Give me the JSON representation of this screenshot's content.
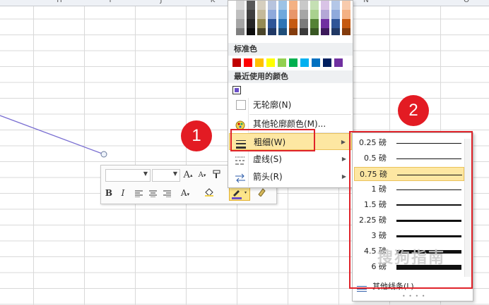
{
  "sheet": {
    "column_letters": [
      "H",
      "I",
      "J",
      "K",
      "N",
      "O"
    ]
  },
  "color_menu": {
    "standard_colors_title": "标准色",
    "recent_colors_title": "最近使用的颜色",
    "theme_columns": [
      [
        "#d8d8d8",
        "#bfbfbf",
        "#a5a5a5",
        "#7f7f7f"
      ],
      [
        "#595959",
        "#3f3f3f",
        "#262626",
        "#0c0c0c"
      ],
      [
        "#d6cfbf",
        "#c4b99a",
        "#948a54",
        "#4a452a"
      ],
      [
        "#b7c4de",
        "#8ea9db",
        "#2e5597",
        "#1f3864"
      ],
      [
        "#9dc3e6",
        "#6fa8dc",
        "#2f75b5",
        "#1f4e79"
      ],
      [
        "#f4b183",
        "#e8966a",
        "#c55a11",
        "#843c0c"
      ],
      [
        "#c9c9c9",
        "#a6a6a6",
        "#7b7b7b",
        "#3a3a3a"
      ],
      [
        "#c5e0b4",
        "#a9d18e",
        "#548235",
        "#385723"
      ],
      [
        "#d9c3e6",
        "#b4a7d6",
        "#7030a0",
        "#3c1a5b"
      ],
      [
        "#b4c7e7",
        "#8faadc",
        "#2f5597",
        "#203864"
      ],
      [
        "#f8cbad",
        "#f4b183",
        "#c55a11",
        "#843c0c"
      ]
    ],
    "standard_colors": [
      "#c00000",
      "#ff0000",
      "#ffc000",
      "#ffff00",
      "#92d050",
      "#00b050",
      "#00b0f0",
      "#0070c0",
      "#002060",
      "#7030a0"
    ],
    "recent_color": "#6a4ec8",
    "items": {
      "no_outline": "无轮廓(N)",
      "more_colors": "其他轮廓颜色(M)...",
      "weight": "粗细(W)",
      "dashes": "虚线(S)",
      "arrows": "箭头(R)"
    }
  },
  "weight_menu": {
    "weights": [
      {
        "label": "0.25 磅",
        "pt": 0.25
      },
      {
        "label": "0.5 磅",
        "pt": 0.5
      },
      {
        "label": "0.75 磅",
        "pt": 0.75
      },
      {
        "label": "1 磅",
        "pt": 1
      },
      {
        "label": "1.5 磅",
        "pt": 1.5
      },
      {
        "label": "2.25 磅",
        "pt": 2.25
      },
      {
        "label": "3 磅",
        "pt": 3
      },
      {
        "label": "4.5 磅",
        "pt": 4.5
      },
      {
        "label": "6 磅",
        "pt": 6
      }
    ],
    "selected": "0.75 磅",
    "more_lines": "其他线条(L)..."
  },
  "annotations": {
    "step1": "1",
    "step2": "2",
    "accent": "#e31b23"
  },
  "watermark": "搜狗指南"
}
